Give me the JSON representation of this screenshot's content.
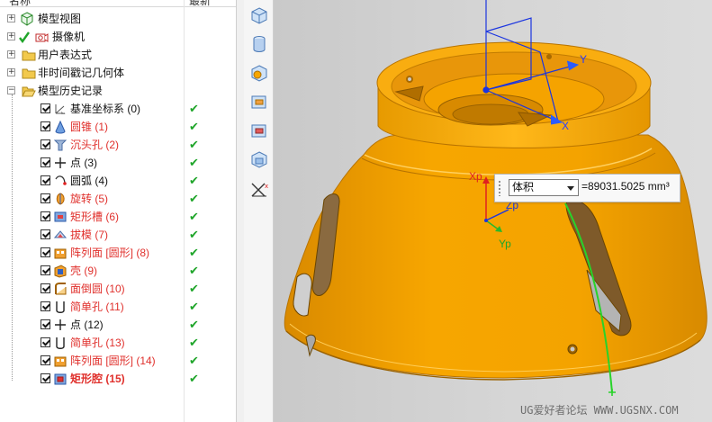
{
  "navigator": {
    "header": {
      "name_col": "名称",
      "latest_col": "最新"
    },
    "top_items": [
      {
        "label": "模型视图",
        "expander": "+"
      },
      {
        "label": "摄像机",
        "expander": "+"
      },
      {
        "label": "用户表达式",
        "expander": "+"
      },
      {
        "label": "非时间戳记几何体",
        "expander": "+"
      },
      {
        "label": "模型历史记录",
        "expander": "−"
      }
    ],
    "history": [
      {
        "label": "基准坐标系 (0)",
        "red": false,
        "bold": false,
        "icon": "datum-csys-icon"
      },
      {
        "label": "圆锥 (1)",
        "red": true,
        "bold": false,
        "icon": "cone-icon"
      },
      {
        "label": "沉头孔 (2)",
        "red": true,
        "bold": false,
        "icon": "countersunk-hole-icon"
      },
      {
        "label": "点 (3)",
        "red": false,
        "bold": false,
        "icon": "point-icon"
      },
      {
        "label": "圆弧 (4)",
        "red": false,
        "bold": false,
        "icon": "arc-icon"
      },
      {
        "label": "旋转 (5)",
        "red": true,
        "bold": false,
        "icon": "revolve-icon"
      },
      {
        "label": "矩形槽 (6)",
        "red": true,
        "bold": false,
        "icon": "rectangular-slot-icon"
      },
      {
        "label": "拔模 (7)",
        "red": true,
        "bold": false,
        "icon": "draft-icon"
      },
      {
        "label": "阵列面 [圆形] (8)",
        "red": true,
        "bold": false,
        "icon": "pattern-face-icon"
      },
      {
        "label": "壳 (9)",
        "red": true,
        "bold": false,
        "icon": "shell-icon"
      },
      {
        "label": "面倒圆 (10)",
        "red": true,
        "bold": false,
        "icon": "face-blend-icon"
      },
      {
        "label": "简单孔 (11)",
        "red": true,
        "bold": false,
        "icon": "simple-hole-icon"
      },
      {
        "label": "点 (12)",
        "red": false,
        "bold": false,
        "icon": "point-icon"
      },
      {
        "label": "简单孔 (13)",
        "red": true,
        "bold": false,
        "icon": "simple-hole-icon"
      },
      {
        "label": "阵列面 [圆形] (14)",
        "red": true,
        "bold": false,
        "icon": "pattern-face-icon"
      },
      {
        "label": "矩形腔 (15)",
        "red": true,
        "bold": true,
        "icon": "rectangular-pocket-icon"
      }
    ],
    "update_mark": "✔"
  },
  "measure": {
    "type": "体积",
    "value": "=89031.5025 mm³"
  },
  "axes": {
    "y": "Y",
    "x": "X",
    "xp": "Xp",
    "yp": "Yp",
    "zp": "Zp"
  },
  "watermark": "UG爱好者论坛 WWW.UGSNX.COM",
  "colors": {
    "part": "#f7a600",
    "red_label": "#e0302c",
    "check_green": "#1fa52a"
  }
}
